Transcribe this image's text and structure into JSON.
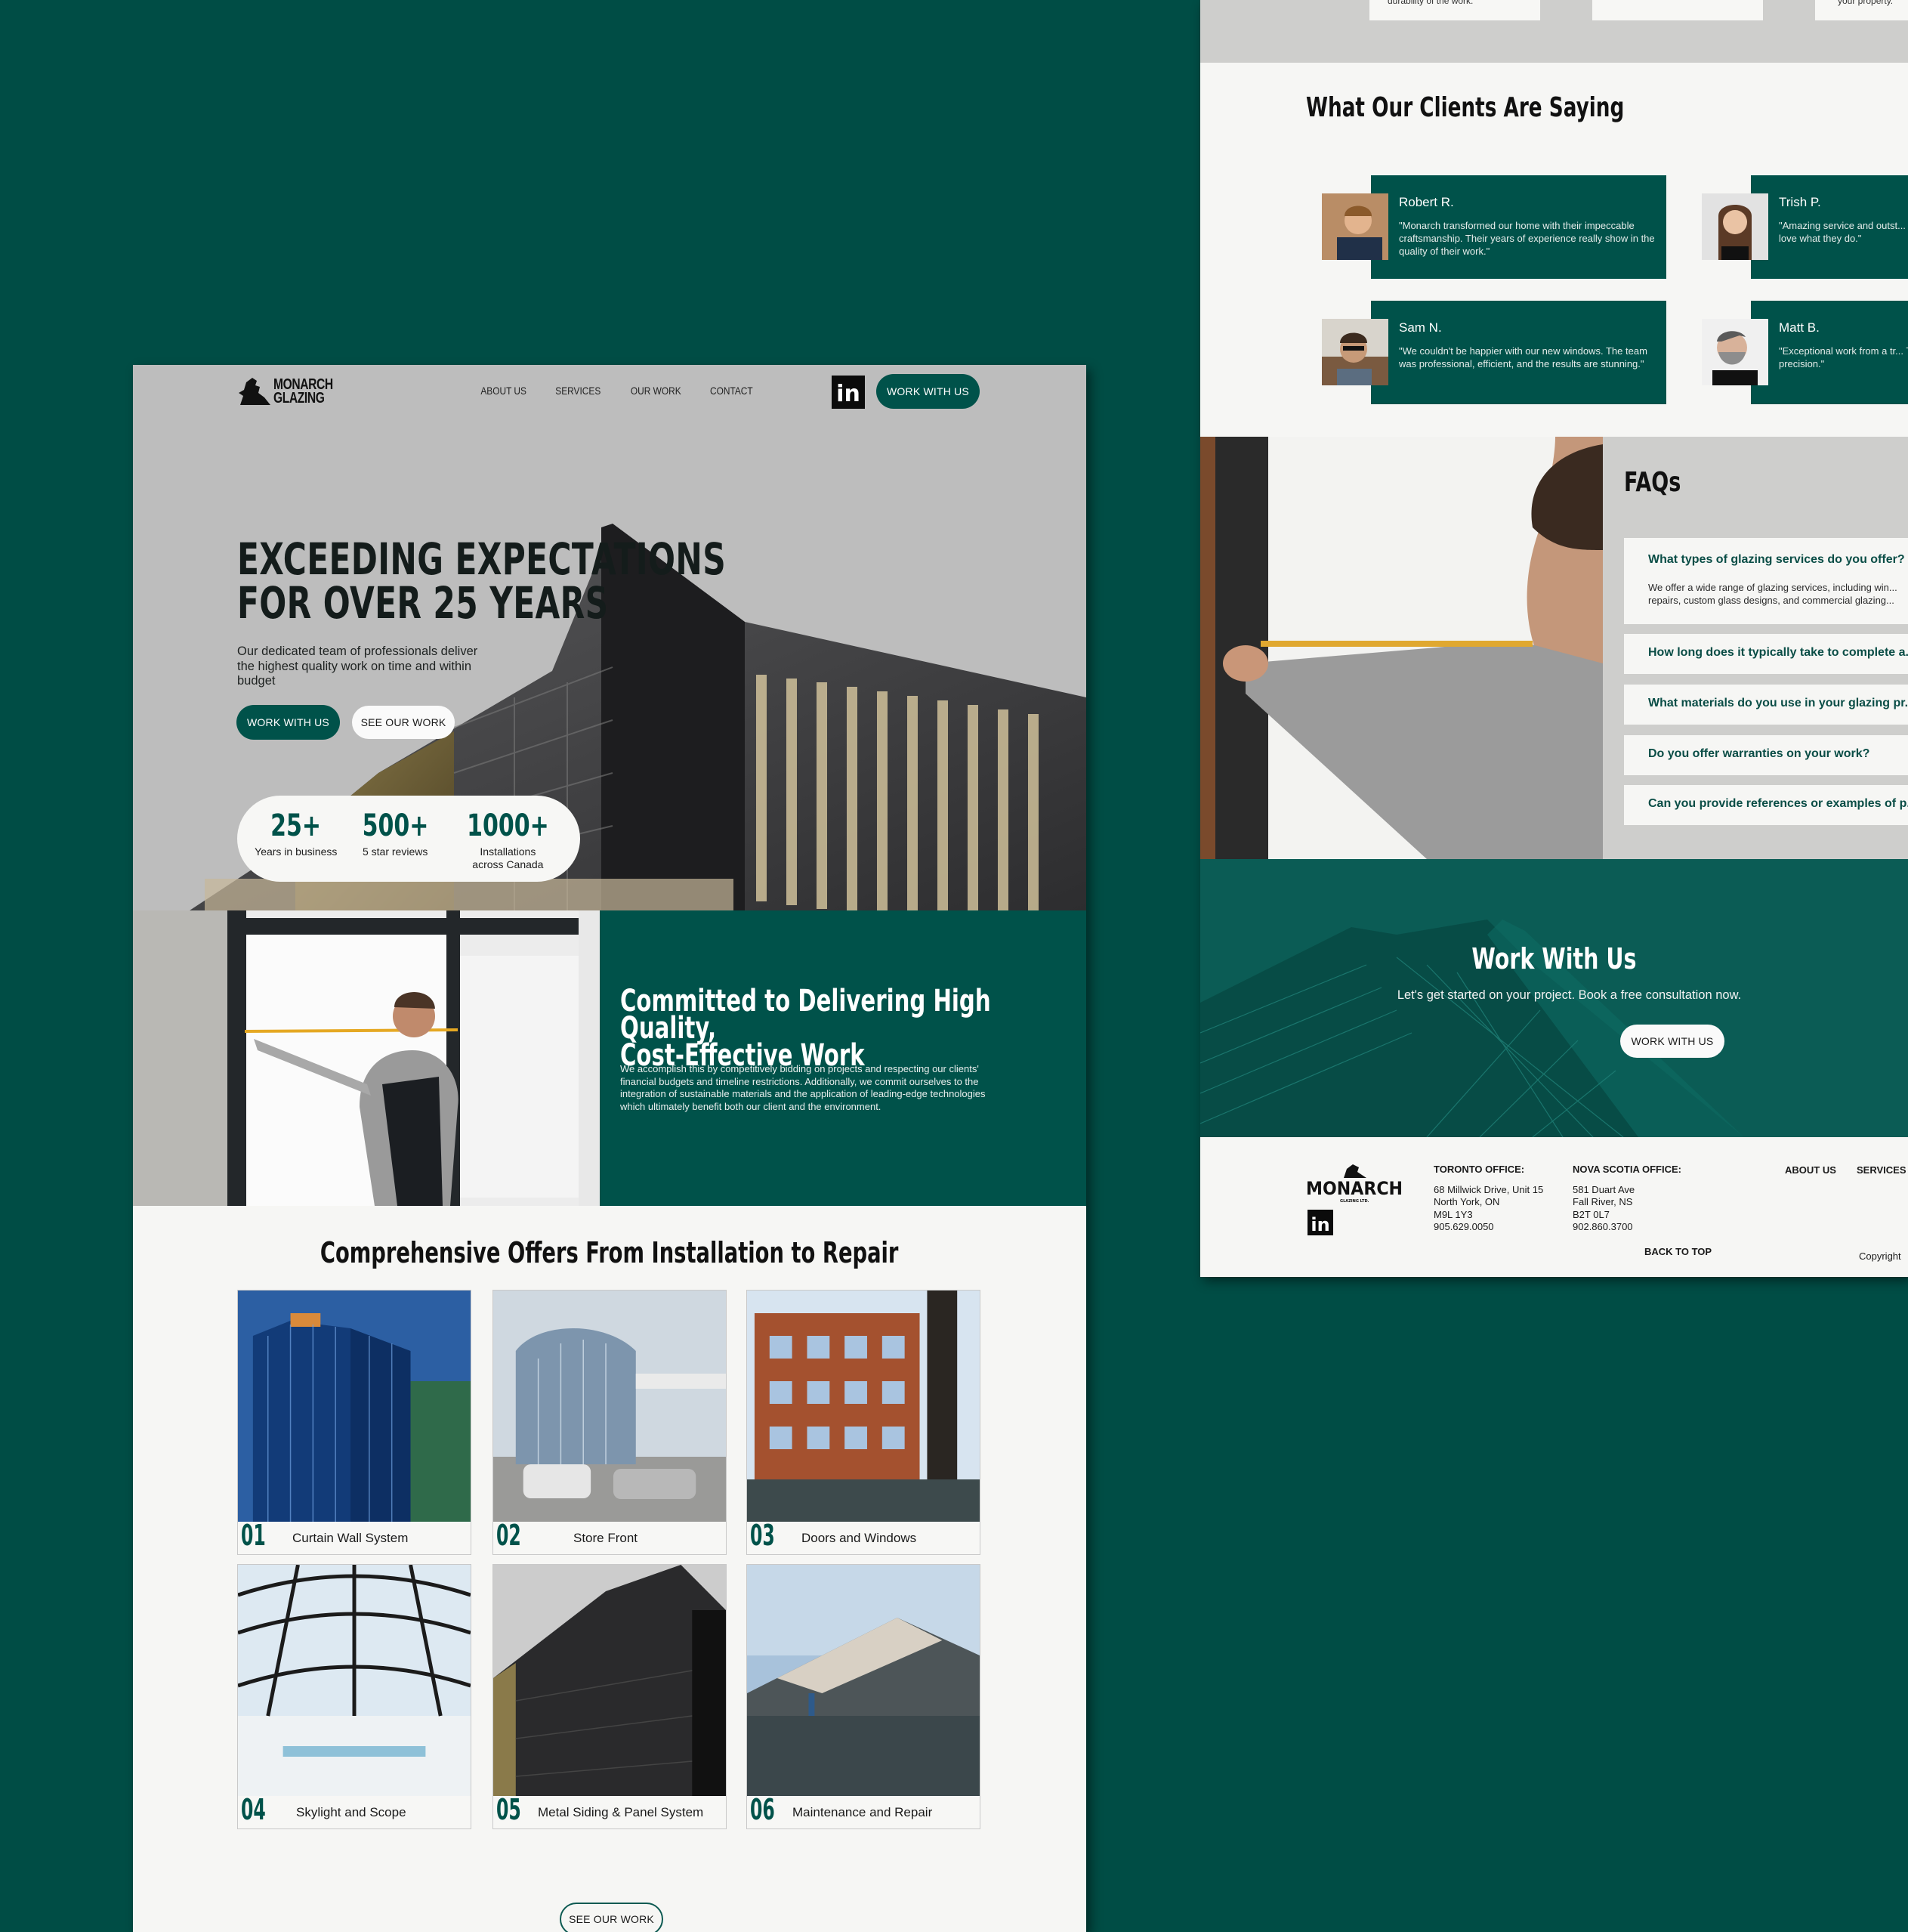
{
  "colors": {
    "brand_green": "#00524a",
    "page_bg": "#004d45",
    "light_bg": "#f6f6f4",
    "gray_band": "#cececc"
  },
  "brand": {
    "line1": "MONARCH",
    "line2": "GLAZING",
    "footer_wordmark": "MONARCH",
    "footer_tagline": "GLAZING LTD."
  },
  "nav": {
    "links": [
      "ABOUT US",
      "SERVICES",
      "OUR WORK",
      "CONTACT"
    ],
    "social_icon": "linkedin-icon",
    "social_label": "in",
    "cta": "WORK WITH US"
  },
  "hero": {
    "title": "EXCEEDING EXPECTATIONS\nFOR OVER 25 YEARS",
    "subtitle": "Our dedicated team of professionals deliver the highest quality work on time and within budget",
    "primary_cta": "WORK WITH US",
    "secondary_cta": "SEE OUR WORK",
    "stats": [
      {
        "value": "25+",
        "label": "Years in business"
      },
      {
        "value": "500+",
        "label": "5 star reviews"
      },
      {
        "value": "1000+",
        "label": "Installations\nacross Canada"
      }
    ]
  },
  "commitment": {
    "title": "Committed to Delivering High Quality,\nCost-Effective Work",
    "body": "We accomplish this by competitively bidding on projects and respecting our clients' financial budgets and timeline restrictions. Additionally, we commit ourselves to the integration of sustainable materials and the application of leading-edge technologies which ultimately benefit both our client and the environment."
  },
  "services": {
    "title": "Comprehensive Offers From Installation to Repair",
    "items": [
      {
        "num": "01",
        "label": "Curtain Wall System"
      },
      {
        "num": "02",
        "label": "Store Front"
      },
      {
        "num": "03",
        "label": "Doors and Windows"
      },
      {
        "num": "04",
        "label": "Skylight and Scope"
      },
      {
        "num": "05",
        "label": "Metal Siding & Panel System"
      },
      {
        "num": "06",
        "label": "Maintenance and Repair"
      }
    ],
    "cta": "SEE OUR WORK"
  },
  "top_cards": {
    "card1_tail": "durability of the work.",
    "card3_tail": "your property."
  },
  "testimonials": {
    "title": "What Our Clients Are Saying",
    "items": [
      {
        "name": "Robert R.",
        "quote": "\"Monarch transformed our home with their impeccable craftsmanship. Their years of experience really show in the quality of their work.\""
      },
      {
        "name": "Trish P.",
        "quote": "\"Amazing service and outst... attention to detail is unmat... love what they do.\""
      },
      {
        "name": "Sam N.",
        "quote": "\"We couldn't be happier with our new windows. The team was professional, efficient, and the results are stunning.\""
      },
      {
        "name": "Matt B.",
        "quote": "\"Exceptional work from a tr... They delivered exactly what... precision.\""
      }
    ]
  },
  "faq": {
    "title": "FAQs",
    "items": [
      {
        "q": "What types of glazing services do you offer?",
        "a": "We offer a wide range of glazing services, including win...\nrepairs, custom glass designs, and commercial glazing..."
      },
      {
        "q": "How long does it typically take to complete a..."
      },
      {
        "q": "What materials do you use in your glazing pr..."
      },
      {
        "q": "Do you offer warranties on your work?"
      },
      {
        "q": "Can you provide references or examples of p..."
      }
    ]
  },
  "work_with_us": {
    "title": "Work With Us",
    "subtitle": "Let's get started on your project. Book a free consultation now.",
    "cta": "WORK WITH US"
  },
  "footer": {
    "offices": [
      {
        "heading": "TORONTO OFFICE:",
        "lines": [
          "68 Millwick Drive, Unit 15",
          "North York, ON",
          "M9L 1Y3",
          "905.629.0050"
        ]
      },
      {
        "heading": "NOVA SCOTIA OFFICE:",
        "lines": [
          "581 Duart Ave",
          "Fall River, NS",
          "B2T 0L7",
          "902.860.3700"
        ]
      }
    ],
    "links": [
      "ABOUT US",
      "SERVICES"
    ],
    "back_to_top": "BACK TO TOP",
    "copyright": "Copyright"
  }
}
